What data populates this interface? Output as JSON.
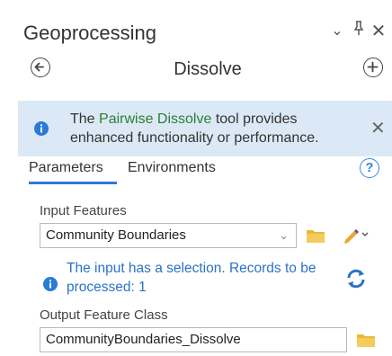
{
  "pane": {
    "title": "Geoprocessing"
  },
  "tool": {
    "name": "Dissolve"
  },
  "banner": {
    "prefix": "The ",
    "link": "Pairwise Dissolve",
    "suffix": " tool provides enhanced functionality or performance."
  },
  "tabs": [
    {
      "label": "Parameters",
      "active": true
    },
    {
      "label": "Environments",
      "active": false
    }
  ],
  "input_features": {
    "label": "Input Features",
    "value": "Community Boundaries"
  },
  "selection_message": "The input has a selection. Records to be processed: 1",
  "output_feature_class": {
    "label": "Output Feature Class",
    "value": "CommunityBoundaries_Dissolve"
  },
  "colors": {
    "banner_bg": "#dbe9f6",
    "accent": "#2a7bd8",
    "link_green": "#2e7d32",
    "folder_yellow": "#e9b93c"
  },
  "icons": {
    "back": "circle-arrow-left",
    "add": "circle-plus",
    "info": "info-circle",
    "help": "question-circle",
    "folder": "folder",
    "pencil": "pencil",
    "refresh": "refresh-arrows"
  }
}
